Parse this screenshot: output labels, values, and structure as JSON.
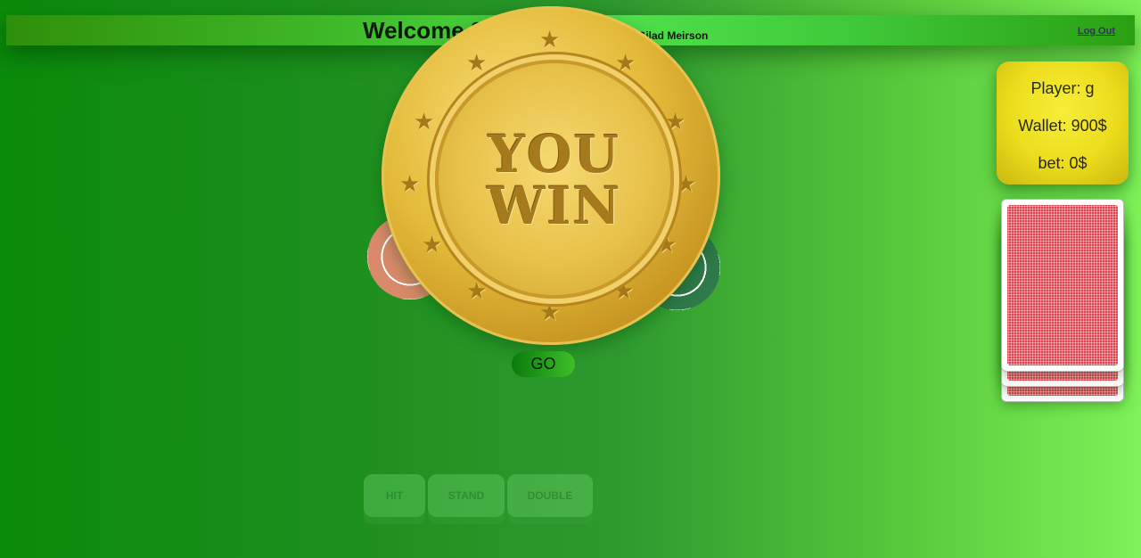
{
  "header": {
    "welcome": "Welcome 2",
    "credit": "d by Gilad Meirson",
    "logout_label": "Log Out"
  },
  "player_info": {
    "player": "Player: g",
    "wallet": "Wallet: 900$",
    "bet": "bet: 0$"
  },
  "overlay": {
    "line1": "YOU",
    "line2": "WIN",
    "icon": "gold-coin-icon"
  },
  "controls": {
    "go_label": "GO",
    "hit_label": "HIT",
    "stand_label": "STAND",
    "double_label": "DOUBLE"
  },
  "colors": {
    "table_green": "#1d8f1d",
    "info_yellow": "#ecdc1c",
    "card_back_red": "#e04652",
    "coin_gold": "#e4bb3a"
  }
}
